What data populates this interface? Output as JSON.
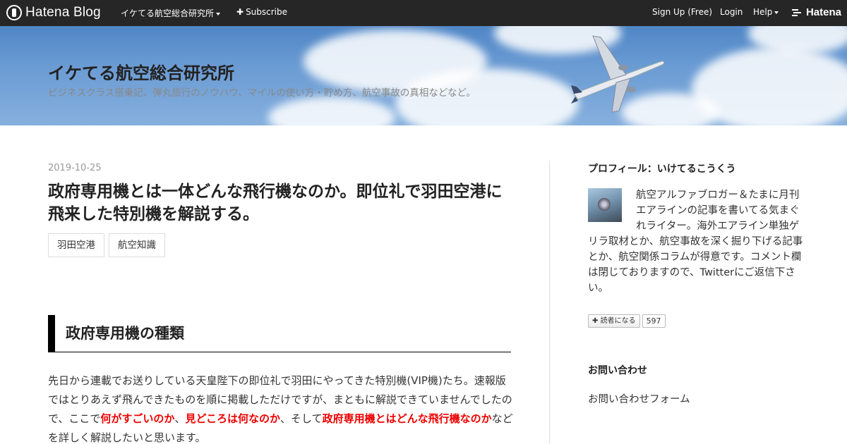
{
  "topbar": {
    "brand": "Hatena Blog",
    "blog_menu": "イケてる航空総合研究所",
    "subscribe": "Subscribe",
    "signup": "Sign Up (Free)",
    "login": "Login",
    "help": "Help",
    "hatena": "Hatena"
  },
  "header": {
    "title": "イケてる航空総合研究所",
    "description": "ビジネスクラス搭乗記、弾丸旅行のノウハウ、マイルの使い方・貯め方、航空事故の真相などなど。"
  },
  "post": {
    "date": "2019-10-25",
    "title": "政府専用機とは一体どんな飛行機なのか。即位礼で羽田空港に飛来した特別機を解説する。",
    "tags": [
      "羽田空港",
      "航空知識"
    ],
    "section_heading": "政府専用機の種類",
    "paragraph": {
      "p1": "先日から連載でお送りしている天皇陛下の即位礼で羽田にやってきた特別機(VIP機)たち。速報版ではとりあえず飛んできたものを順に掲載しただけですが、まともに解説できていませんでしたので、ここで",
      "e1": "何がすごいのか",
      "p2": "、",
      "e2": "見どころは何なのか",
      "p3": "、そして",
      "e3": "政府専用機とはどんな飛行機なのか",
      "p4": "などを詳しく解説したいと思います。"
    }
  },
  "sidebar": {
    "profile_heading": "プロフィール：いけてるこうくう",
    "profile_text": "航空アルファブロガー＆たまに月刊エアラインの記事を書いてる気まぐれライター。海外エアライン単独ゲリラ取材とか、航空事故を深く掘り下げる記事とか、航空関係コラムが得意です。コメント欄は閉じておりますので、Twitterにご返信下さい。",
    "subscribe_label": "読者になる",
    "subscriber_count": "597",
    "contact_heading": "お問い合わせ",
    "contact_link": "お問い合わせフォーム"
  },
  "colors": {
    "topbar_bg": "#262626",
    "emphasis": "#ee0000",
    "sky": "#5b8fcb"
  }
}
